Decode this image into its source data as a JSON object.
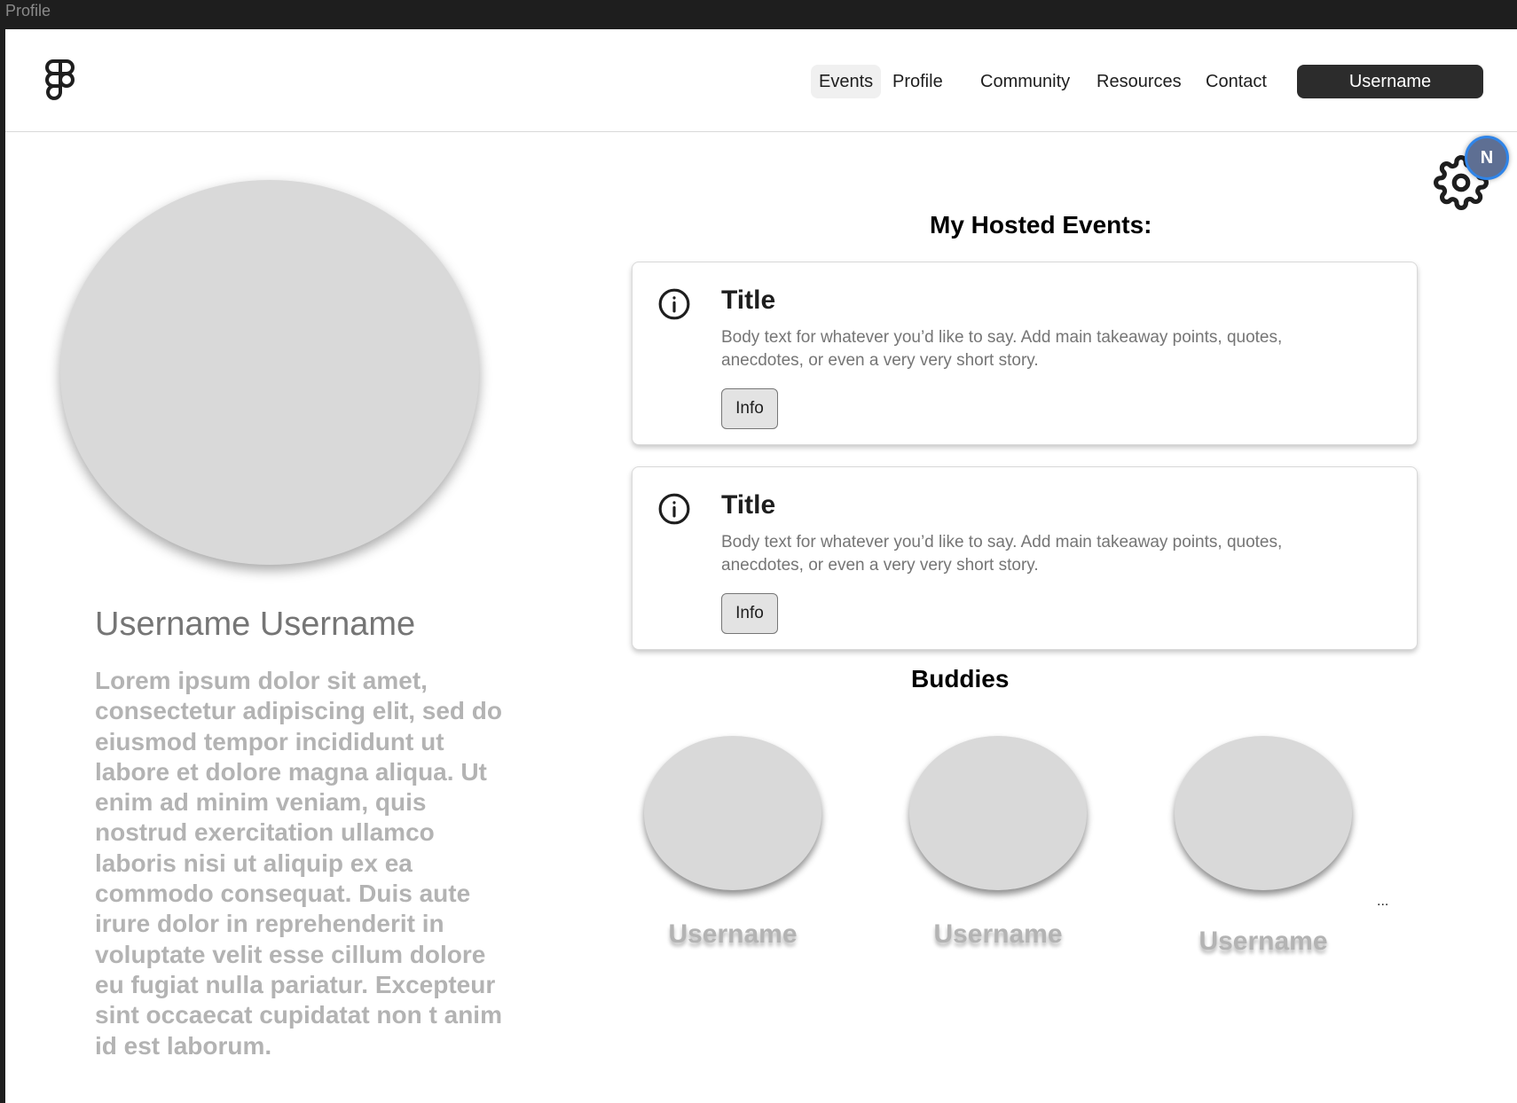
{
  "frame": {
    "label": "Profile"
  },
  "nav": {
    "links": [
      "Events",
      "Profile",
      "Community",
      "Resources",
      "Contact"
    ],
    "active": "Events",
    "user_button": "Username"
  },
  "settings": {
    "icon": "gear-icon",
    "badge_initial": "N"
  },
  "profile": {
    "name": "Username Username",
    "bio": "Lorem ipsum dolor sit amet, consectetur adipiscing elit, sed do eiusmod tempor incididunt ut labore et dolore magna aliqua. Ut enim ad minim veniam, quis nostrud exercitation ullamco laboris nisi ut aliquip ex ea commodo consequat. Duis aute irure dolor in reprehenderit in voluptate velit esse cillum dolore eu fugiat nulla pariatur. Excepteur sint occaecat cupidatat non t anim id est laborum."
  },
  "hosted_events": {
    "title": "My Hosted Events:",
    "cards": [
      {
        "title": "Title",
        "body": "Body text for whatever you’d like to say. Add main takeaway points, quotes, anecdotes, or even a very very short story.",
        "button": "Info"
      },
      {
        "title": "Title",
        "body": "Body text for whatever you’d like to say. Add main takeaway points, quotes, anecdotes, or even a very very short story.",
        "button": "Info"
      }
    ]
  },
  "buddies": {
    "title": "Buddies",
    "items": [
      {
        "name": "Username"
      },
      {
        "name": "Username"
      },
      {
        "name": "Username"
      }
    ],
    "more": "..."
  }
}
